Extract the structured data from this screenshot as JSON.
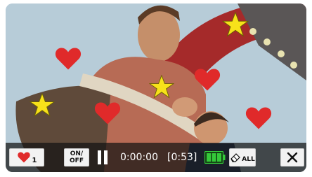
{
  "favorite_button": {
    "count": "1",
    "icon": "heart-icon"
  },
  "onoff_button": {
    "line1": "ON/",
    "line2": "OFF"
  },
  "playback": {
    "state_icon": "pause-icon",
    "elapsed": "0:00:00",
    "duration": "[0:53]"
  },
  "battery": {
    "icon": "battery-icon",
    "color": "#35c93a"
  },
  "clear_all_button": {
    "label": "ALL",
    "icon": "eraser-icon"
  },
  "close_button": {
    "icon": "close-icon"
  },
  "colors": {
    "heart": "#e02a2a",
    "star": "#f7e11a",
    "bar": "#141414"
  }
}
